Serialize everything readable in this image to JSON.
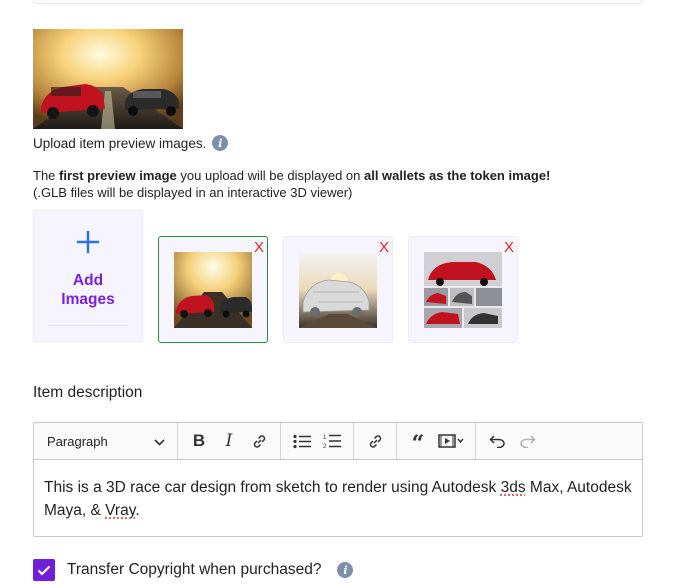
{
  "upload": {
    "label": "Upload item preview images.",
    "note_first_prefix": "The ",
    "note_first_bold": "first preview image",
    "note_first_mid": " you upload will be displayed on ",
    "note_first_bold2": "all wallets as the token image!",
    "note_glb": "(.GLB files will be displayed in an interactive 3D viewer)",
    "add_label": "Add Images",
    "add_icon": "plus-icon",
    "remove_label": "X",
    "thumbnails": [
      {
        "name": "red-cars-sunset",
        "selected": true
      },
      {
        "name": "sketch-to-render",
        "selected": false
      },
      {
        "name": "car-collage",
        "selected": false
      }
    ]
  },
  "description": {
    "label": "Item description",
    "block_format": "Paragraph",
    "text_part1": "This is a 3D race car design from sketch to render using Autodesk ",
    "text_spell1": "3ds",
    "text_part2": " Max, Autodesk Maya, & ",
    "text_spell2": "Vray",
    "text_part3": ".",
    "toolbar_icons": [
      "bold-icon",
      "italic-icon",
      "link-icon",
      "bulleted-list-icon",
      "numbered-list-icon",
      "link-icon",
      "blockquote-icon",
      "media-embed-icon",
      "undo-icon",
      "redo-icon"
    ]
  },
  "copyright": {
    "label": "Transfer Copyright when purchased?",
    "checked": true
  },
  "colors": {
    "accent_purple": "#6f1fd8",
    "add_blue": "#2b6fe0",
    "remove_red": "#e02424",
    "selected_green": "#2e8b3e"
  }
}
